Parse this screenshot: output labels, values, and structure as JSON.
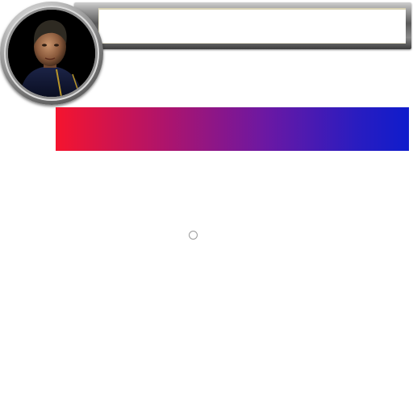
{
  "hud": {
    "target_name": "",
    "portrait_icon": "character-portrait",
    "gauge": {
      "fill_fraction": 1.0,
      "color_start": "#f5142e",
      "color_end": "#0f1ccc"
    },
    "marker_icon": "crosshair-ring"
  }
}
